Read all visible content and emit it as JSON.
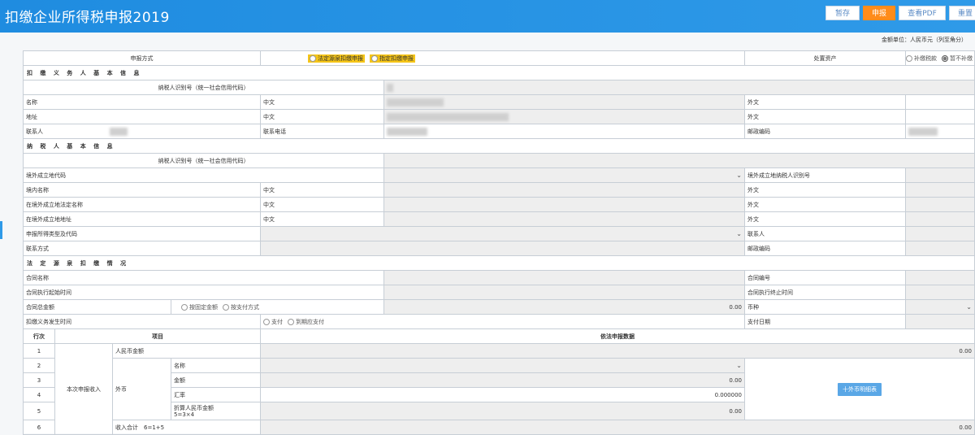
{
  "header": {
    "title": "扣缴企业所得税申报2019",
    "buttons": [
      "暂存",
      "申报",
      "查看PDF",
      "重置"
    ]
  },
  "unit_note": "金额单位：人民币元（列至角分）",
  "row_declaration": {
    "label": "申报方式",
    "opt1": "法定源泉扣缴申报",
    "opt2": "指定扣缴申报",
    "asset_label": "处置资产",
    "asset_opt1": "补缴税款",
    "asset_opt2": "暂不补缴"
  },
  "section1": {
    "title": "扣 缴 义 务 人 基 本 信 息",
    "taxid_label": "纳税人识别号（统一社会信用代码）",
    "name": "名称",
    "chinese": "中文",
    "foreign": "外文",
    "address": "地址",
    "contact": "联系人",
    "phone": "联系电话",
    "postcode": "邮政编码"
  },
  "section2": {
    "title": "纳 税 人 基 本 信 息",
    "taxid_label": "纳税人识别号（统一社会信用代码）",
    "abroad_code": "境外成立地代码",
    "abroad_taxid": "境外成立地纳税人识别号",
    "domestic_name": "境内名称",
    "abroad_legal_name": "在境外成立地法定名称",
    "abroad_address": "在境外成立地地址",
    "income_type": "申报所得类型及代码",
    "contact": "联系人",
    "contact_method": "联系方式",
    "postcode": "邮政编码",
    "chinese": "中文",
    "foreign": "外文"
  },
  "section3": {
    "title": "法 定 源 泉 扣 缴 情 况",
    "contract_name": "合同名称",
    "contract_no": "合同编号",
    "start_time": "合同执行起始时间",
    "end_time": "合同执行终止时间",
    "total_amount": "合同总金额",
    "opt_fixed": "按固定金额",
    "opt_pay": "按支付方式",
    "amount_value": "0.00",
    "currency": "币种",
    "obligation_time": "扣缴义务发生时间",
    "opt_paid": "支付",
    "opt_due": "到期应支付",
    "pay_date": "支付日期"
  },
  "table": {
    "col_line": "行次",
    "col_item": "项目",
    "col_data": "依法申报数据",
    "group_label": "本次申报收入",
    "foreign_label": "外币",
    "rows": [
      {
        "no": "1",
        "item": "人民币金额",
        "value": "0.00"
      },
      {
        "no": "2",
        "item": "名称",
        "value": ""
      },
      {
        "no": "3",
        "item": "金额",
        "value": "0.00"
      },
      {
        "no": "4",
        "item": "汇率",
        "value": "0.000000"
      },
      {
        "no": "5",
        "item": "折算人民币金额",
        "formula": "5=3×4",
        "value": "0.00"
      },
      {
        "no": "6",
        "item": "收入合计　6=1+5",
        "value": "0.00"
      }
    ],
    "fx_button": "十外币明细表"
  }
}
